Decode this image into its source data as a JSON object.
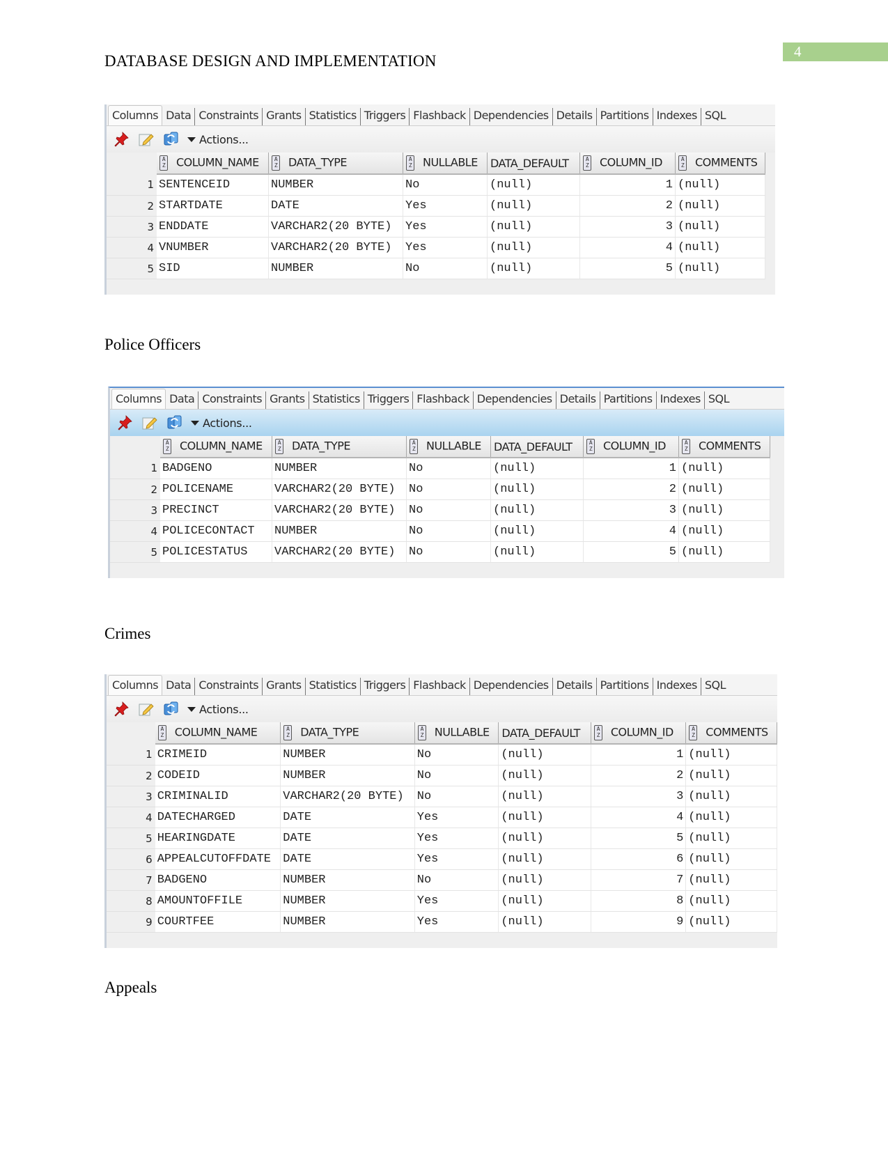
{
  "header": {
    "title": "DATABASE DESIGN AND IMPLEMENTATION",
    "page_number": "4",
    "page_badge_color": "#a8d08d"
  },
  "tabs": [
    "Columns",
    "Data",
    "Constraints",
    "Grants",
    "Statistics",
    "Triggers",
    "Flashback",
    "Dependencies",
    "Details",
    "Partitions",
    "Indexes",
    "SQL"
  ],
  "toolbar": {
    "icons": [
      "pin-icon",
      "edit-icon",
      "refresh-icon"
    ],
    "actions_label": "Actions..."
  },
  "columns": [
    "COLUMN_NAME",
    "DATA_TYPE",
    "NULLABLE",
    "DATA_DEFAULT",
    "COLUMN_ID",
    "COMMENTS"
  ],
  "sections": [
    {
      "label": "",
      "rows": [
        [
          "1",
          "SENTENCEID",
          "NUMBER",
          "No",
          "(null)",
          "1",
          "(null)"
        ],
        [
          "2",
          "STARTDATE",
          "DATE",
          "Yes",
          "(null)",
          "2",
          "(null)"
        ],
        [
          "3",
          "ENDDATE",
          "VARCHAR2(20 BYTE)",
          "Yes",
          "(null)",
          "3",
          "(null)"
        ],
        [
          "4",
          "VNUMBER",
          "VARCHAR2(20 BYTE)",
          "Yes",
          "(null)",
          "4",
          "(null)"
        ],
        [
          "5",
          "SID",
          "NUMBER",
          "No",
          "(null)",
          "5",
          "(null)"
        ]
      ]
    },
    {
      "label": "Police Officers",
      "rows": [
        [
          "1",
          "BADGENO",
          "NUMBER",
          "No",
          "(null)",
          "1",
          "(null)"
        ],
        [
          "2",
          "POLICENAME",
          "VARCHAR2(20 BYTE)",
          "No",
          "(null)",
          "2",
          "(null)"
        ],
        [
          "3",
          "PRECINCT",
          "VARCHAR2(20 BYTE)",
          "No",
          "(null)",
          "3",
          "(null)"
        ],
        [
          "4",
          "POLICECONTACT",
          "NUMBER",
          "No",
          "(null)",
          "4",
          "(null)"
        ],
        [
          "5",
          "POLICESTATUS",
          "VARCHAR2(20 BYTE)",
          "No",
          "(null)",
          "5",
          "(null)"
        ]
      ]
    },
    {
      "label": "Crimes",
      "rows": [
        [
          "1",
          "CRIMEID",
          "NUMBER",
          "No",
          "(null)",
          "1",
          "(null)"
        ],
        [
          "2",
          "CODEID",
          "NUMBER",
          "No",
          "(null)",
          "2",
          "(null)"
        ],
        [
          "3",
          "CRIMINALID",
          "VARCHAR2(20 BYTE)",
          "No",
          "(null)",
          "3",
          "(null)"
        ],
        [
          "4",
          "DATECHARGED",
          "DATE",
          "Yes",
          "(null)",
          "4",
          "(null)"
        ],
        [
          "5",
          "HEARINGDATE",
          "DATE",
          "Yes",
          "(null)",
          "5",
          "(null)"
        ],
        [
          "6",
          "APPEALCUTOFFDATE",
          "DATE",
          "Yes",
          "(null)",
          "6",
          "(null)"
        ],
        [
          "7",
          "BADGENO",
          "NUMBER",
          "No",
          "(null)",
          "7",
          "(null)"
        ],
        [
          "8",
          "AMOUNTOFFILE",
          "NUMBER",
          "Yes",
          "(null)",
          "8",
          "(null)"
        ],
        [
          "9",
          "COURTFEE",
          "NUMBER",
          "Yes",
          "(null)",
          "9",
          "(null)"
        ]
      ]
    },
    {
      "label": "Appeals",
      "rows": []
    }
  ]
}
